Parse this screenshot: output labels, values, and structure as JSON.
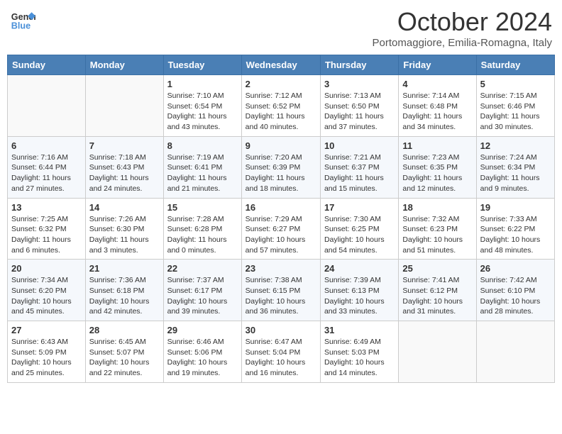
{
  "header": {
    "logo_general": "General",
    "logo_blue": "Blue",
    "month_title": "October 2024",
    "subtitle": "Portomaggiore, Emilia-Romagna, Italy"
  },
  "days_of_week": [
    "Sunday",
    "Monday",
    "Tuesday",
    "Wednesday",
    "Thursday",
    "Friday",
    "Saturday"
  ],
  "weeks": [
    [
      {
        "day": "",
        "info": ""
      },
      {
        "day": "",
        "info": ""
      },
      {
        "day": "1",
        "info": "Sunrise: 7:10 AM\nSunset: 6:54 PM\nDaylight: 11 hours and 43 minutes."
      },
      {
        "day": "2",
        "info": "Sunrise: 7:12 AM\nSunset: 6:52 PM\nDaylight: 11 hours and 40 minutes."
      },
      {
        "day": "3",
        "info": "Sunrise: 7:13 AM\nSunset: 6:50 PM\nDaylight: 11 hours and 37 minutes."
      },
      {
        "day": "4",
        "info": "Sunrise: 7:14 AM\nSunset: 6:48 PM\nDaylight: 11 hours and 34 minutes."
      },
      {
        "day": "5",
        "info": "Sunrise: 7:15 AM\nSunset: 6:46 PM\nDaylight: 11 hours and 30 minutes."
      }
    ],
    [
      {
        "day": "6",
        "info": "Sunrise: 7:16 AM\nSunset: 6:44 PM\nDaylight: 11 hours and 27 minutes."
      },
      {
        "day": "7",
        "info": "Sunrise: 7:18 AM\nSunset: 6:43 PM\nDaylight: 11 hours and 24 minutes."
      },
      {
        "day": "8",
        "info": "Sunrise: 7:19 AM\nSunset: 6:41 PM\nDaylight: 11 hours and 21 minutes."
      },
      {
        "day": "9",
        "info": "Sunrise: 7:20 AM\nSunset: 6:39 PM\nDaylight: 11 hours and 18 minutes."
      },
      {
        "day": "10",
        "info": "Sunrise: 7:21 AM\nSunset: 6:37 PM\nDaylight: 11 hours and 15 minutes."
      },
      {
        "day": "11",
        "info": "Sunrise: 7:23 AM\nSunset: 6:35 PM\nDaylight: 11 hours and 12 minutes."
      },
      {
        "day": "12",
        "info": "Sunrise: 7:24 AM\nSunset: 6:34 PM\nDaylight: 11 hours and 9 minutes."
      }
    ],
    [
      {
        "day": "13",
        "info": "Sunrise: 7:25 AM\nSunset: 6:32 PM\nDaylight: 11 hours and 6 minutes."
      },
      {
        "day": "14",
        "info": "Sunrise: 7:26 AM\nSunset: 6:30 PM\nDaylight: 11 hours and 3 minutes."
      },
      {
        "day": "15",
        "info": "Sunrise: 7:28 AM\nSunset: 6:28 PM\nDaylight: 11 hours and 0 minutes."
      },
      {
        "day": "16",
        "info": "Sunrise: 7:29 AM\nSunset: 6:27 PM\nDaylight: 10 hours and 57 minutes."
      },
      {
        "day": "17",
        "info": "Sunrise: 7:30 AM\nSunset: 6:25 PM\nDaylight: 10 hours and 54 minutes."
      },
      {
        "day": "18",
        "info": "Sunrise: 7:32 AM\nSunset: 6:23 PM\nDaylight: 10 hours and 51 minutes."
      },
      {
        "day": "19",
        "info": "Sunrise: 7:33 AM\nSunset: 6:22 PM\nDaylight: 10 hours and 48 minutes."
      }
    ],
    [
      {
        "day": "20",
        "info": "Sunrise: 7:34 AM\nSunset: 6:20 PM\nDaylight: 10 hours and 45 minutes."
      },
      {
        "day": "21",
        "info": "Sunrise: 7:36 AM\nSunset: 6:18 PM\nDaylight: 10 hours and 42 minutes."
      },
      {
        "day": "22",
        "info": "Sunrise: 7:37 AM\nSunset: 6:17 PM\nDaylight: 10 hours and 39 minutes."
      },
      {
        "day": "23",
        "info": "Sunrise: 7:38 AM\nSunset: 6:15 PM\nDaylight: 10 hours and 36 minutes."
      },
      {
        "day": "24",
        "info": "Sunrise: 7:39 AM\nSunset: 6:13 PM\nDaylight: 10 hours and 33 minutes."
      },
      {
        "day": "25",
        "info": "Sunrise: 7:41 AM\nSunset: 6:12 PM\nDaylight: 10 hours and 31 minutes."
      },
      {
        "day": "26",
        "info": "Sunrise: 7:42 AM\nSunset: 6:10 PM\nDaylight: 10 hours and 28 minutes."
      }
    ],
    [
      {
        "day": "27",
        "info": "Sunrise: 6:43 AM\nSunset: 5:09 PM\nDaylight: 10 hours and 25 minutes."
      },
      {
        "day": "28",
        "info": "Sunrise: 6:45 AM\nSunset: 5:07 PM\nDaylight: 10 hours and 22 minutes."
      },
      {
        "day": "29",
        "info": "Sunrise: 6:46 AM\nSunset: 5:06 PM\nDaylight: 10 hours and 19 minutes."
      },
      {
        "day": "30",
        "info": "Sunrise: 6:47 AM\nSunset: 5:04 PM\nDaylight: 10 hours and 16 minutes."
      },
      {
        "day": "31",
        "info": "Sunrise: 6:49 AM\nSunset: 5:03 PM\nDaylight: 10 hours and 14 minutes."
      },
      {
        "day": "",
        "info": ""
      },
      {
        "day": "",
        "info": ""
      }
    ]
  ]
}
